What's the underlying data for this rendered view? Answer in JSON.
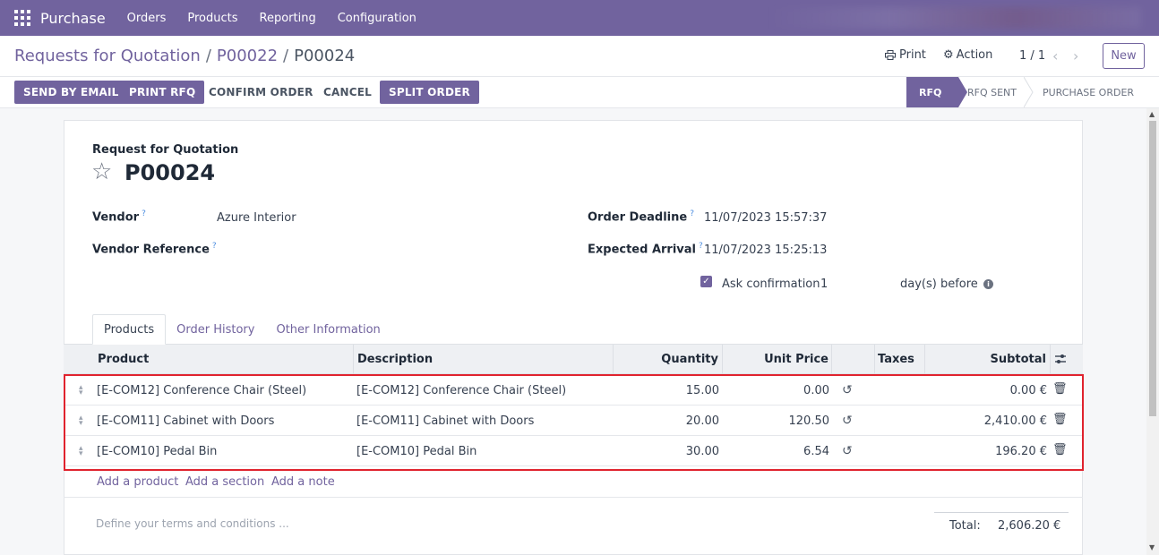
{
  "navbar": {
    "brand": "Purchase",
    "menu": [
      "Orders",
      "Products",
      "Reporting",
      "Configuration"
    ]
  },
  "breadcrumb": {
    "items": [
      "Requests for Quotation",
      "P00022"
    ],
    "current": "P00024"
  },
  "control": {
    "print": "Print",
    "action": "Action",
    "pager": "1 / 1",
    "new": "New"
  },
  "statusbar": {
    "buttons": [
      "SEND BY EMAIL",
      "PRINT RFQ",
      "CONFIRM ORDER",
      "CANCEL",
      "SPLIT ORDER"
    ],
    "stages": [
      "RFQ",
      "RFQ SENT",
      "PURCHASE ORDER"
    ],
    "active_stage": "RFQ"
  },
  "form": {
    "title_label": "Request for Quotation",
    "name": "P00024",
    "vendor_label": "Vendor",
    "vendor": "Azure Interior",
    "vendor_ref_label": "Vendor Reference",
    "deadline_label": "Order Deadline",
    "deadline": "11/07/2023 15:57:37",
    "arrival_label": "Expected Arrival",
    "arrival": "11/07/2023 15:25:13",
    "ask_confirmation_label": "Ask confirmation",
    "ask_confirmation_days": "1",
    "days_before": "day(s) before",
    "help_mark": "?"
  },
  "tabs": [
    "Products",
    "Order History",
    "Other Information"
  ],
  "table": {
    "headers": {
      "product": "Product",
      "description": "Description",
      "quantity": "Quantity",
      "unit_price": "Unit Price",
      "taxes": "Taxes",
      "subtotal": "Subtotal"
    },
    "rows": [
      {
        "product": "[E-COM12] Conference Chair (Steel)",
        "description": "[E-COM12] Conference Chair (Steel)",
        "quantity": "15.00",
        "unit_price": "0.00",
        "subtotal": "0.00 €"
      },
      {
        "product": "[E-COM11] Cabinet with Doors",
        "description": "[E-COM11] Cabinet with Doors",
        "quantity": "20.00",
        "unit_price": "120.50",
        "subtotal": "2,410.00 €"
      },
      {
        "product": "[E-COM10] Pedal Bin",
        "description": "[E-COM10] Pedal Bin",
        "quantity": "30.00",
        "unit_price": "6.54",
        "subtotal": "196.20 €"
      }
    ]
  },
  "add_links": [
    "Add a product",
    "Add a section",
    "Add a note"
  ],
  "footer": {
    "terms_placeholder": "Define your terms and conditions ...",
    "total_label": "Total:",
    "total_value": "2,606.20 €"
  },
  "colors": {
    "brand": "#71639e",
    "highlight": "#e0232e"
  }
}
